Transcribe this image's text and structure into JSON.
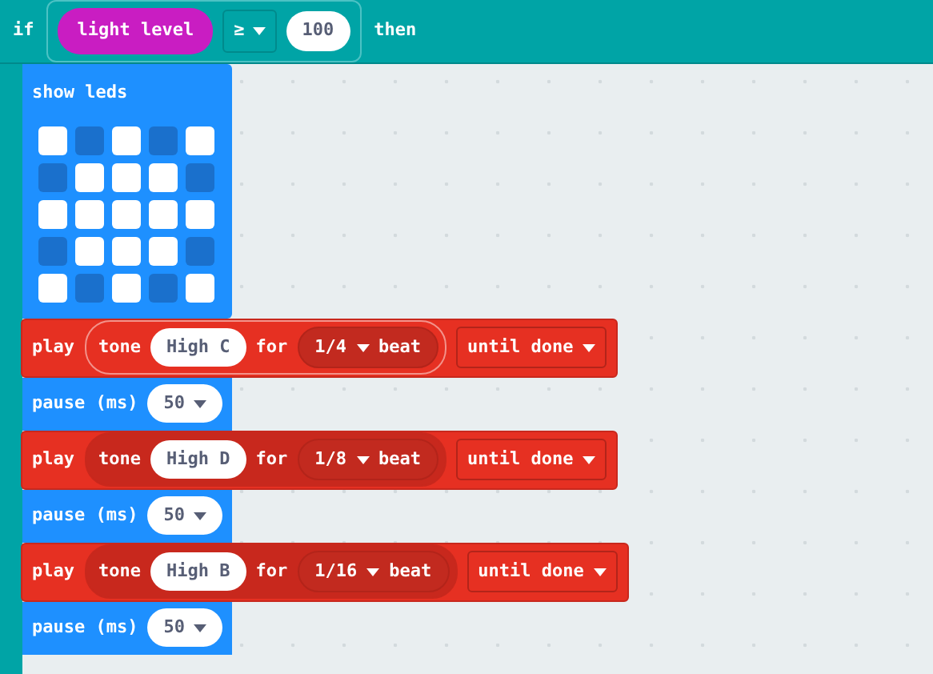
{
  "if_block": {
    "keyword": "if",
    "condition": {
      "sensor": "light level",
      "operator": "≥",
      "value": "100"
    },
    "then": "then"
  },
  "show_leds": {
    "label": "show leds",
    "leds": [
      [
        true,
        false,
        true,
        false,
        true
      ],
      [
        false,
        true,
        true,
        true,
        false
      ],
      [
        true,
        true,
        true,
        true,
        true
      ],
      [
        false,
        true,
        true,
        true,
        false
      ],
      [
        true,
        false,
        true,
        false,
        true
      ]
    ]
  },
  "statements": [
    {
      "kind": "play",
      "play": "play",
      "tone": "tone",
      "note": "High C",
      "for": "for",
      "beat": "1/4",
      "beat_word": "beat",
      "mode": "until done",
      "highlighted": true
    },
    {
      "kind": "pause",
      "label": "pause (ms)",
      "value": "50"
    },
    {
      "kind": "play",
      "play": "play",
      "tone": "tone",
      "note": "High D",
      "for": "for",
      "beat": "1/8",
      "beat_word": "beat",
      "mode": "until done",
      "highlighted": false
    },
    {
      "kind": "pause",
      "label": "pause (ms)",
      "value": "50"
    },
    {
      "kind": "play",
      "play": "play",
      "tone": "tone",
      "note": "High B",
      "for": "for",
      "beat": "1/16",
      "beat_word": "beat",
      "mode": "until done",
      "highlighted": false
    },
    {
      "kind": "pause",
      "label": "pause (ms)",
      "value": "50"
    }
  ]
}
